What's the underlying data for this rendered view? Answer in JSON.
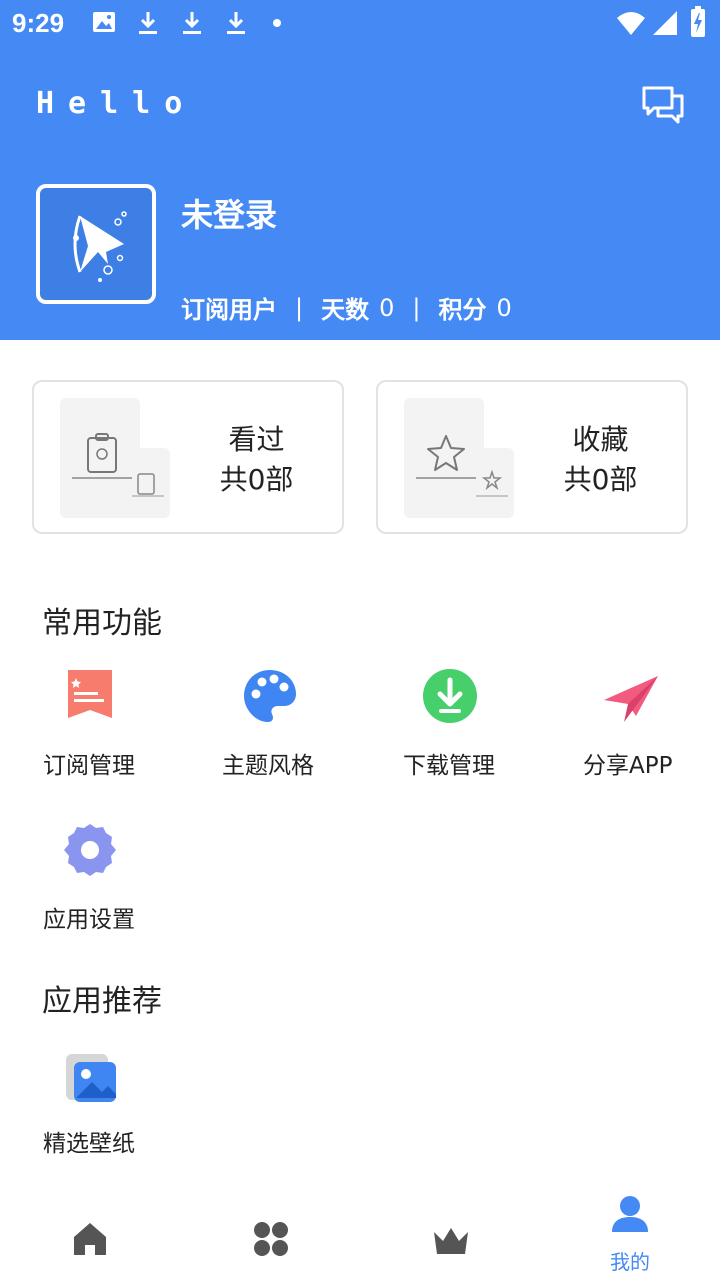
{
  "status_bar": {
    "time": "9:29",
    "icons": [
      "image-icon",
      "download-icon",
      "download-icon",
      "download-icon",
      "dot-icon"
    ],
    "right_icons": [
      "wifi-icon",
      "signal-icon",
      "battery-charging-icon"
    ]
  },
  "header": {
    "title": "Hello",
    "message_icon": "chat-icon",
    "user": {
      "name": "未登录",
      "subscription_label": "订阅用户",
      "days_label": "天数",
      "days_value": "0",
      "points_label": "积分",
      "points_value": "0"
    },
    "background_color": "#4489f4"
  },
  "cards": [
    {
      "title": "看过",
      "count": "共0部",
      "icon": "history-illustration"
    },
    {
      "title": "收藏",
      "count": "共0部",
      "icon": "star-illustration"
    }
  ],
  "sections": {
    "common": {
      "title": "常用功能",
      "items": [
        {
          "label": "订阅管理",
          "icon": "subscription-icon",
          "color": "#f77c6d"
        },
        {
          "label": "主题风格",
          "icon": "palette-icon",
          "color": "#3f86f2"
        },
        {
          "label": "下载管理",
          "icon": "download-circle-icon",
          "color": "#47cf6b"
        },
        {
          "label": "分享APP",
          "icon": "paper-plane-icon",
          "color": "#f35a7f"
        },
        {
          "label": "应用设置",
          "icon": "gear-icon",
          "color": "#8a95ef"
        }
      ]
    },
    "recommend": {
      "title": "应用推荐",
      "items": [
        {
          "label": "精选壁纸",
          "icon": "wallpaper-icon",
          "color": "#3f86f2"
        }
      ]
    }
  },
  "bottom_nav": {
    "items": [
      {
        "icon": "home-icon",
        "label": ""
      },
      {
        "icon": "grid-icon",
        "label": ""
      },
      {
        "icon": "crown-icon",
        "label": ""
      },
      {
        "icon": "person-icon",
        "label": "我的",
        "active": true
      }
    ],
    "active_color": "#4489f4",
    "inactive_color": "#555555"
  }
}
